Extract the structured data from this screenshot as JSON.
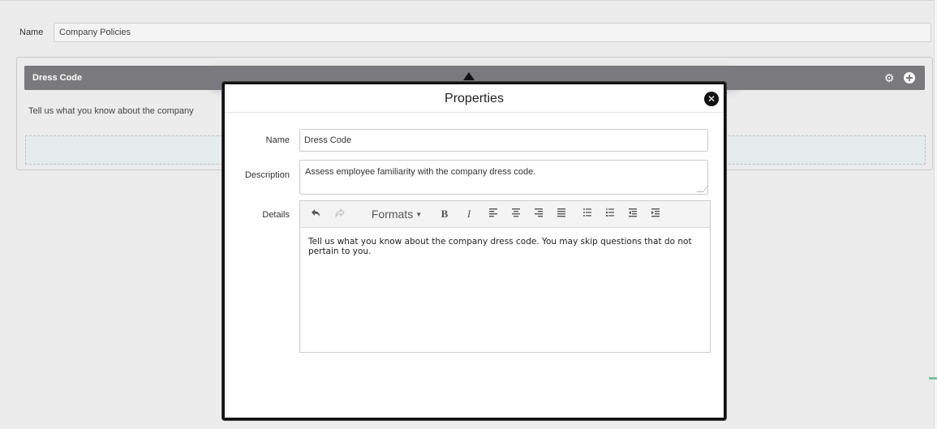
{
  "form": {
    "name_label": "Name",
    "name_value": "Company Policies"
  },
  "section": {
    "title": "Dress Code",
    "description": "Tell us what you know about the company",
    "icons": [
      "gear-icon",
      "add-circle-icon"
    ]
  },
  "dialog": {
    "title": "Properties",
    "close_icon": "close-icon",
    "name_label": "Name",
    "name_value": "Dress Code",
    "description_label": "Description",
    "description_value": "Assess employee familiarity with the company dress code.",
    "details_label": "Details",
    "toolbar": {
      "formats_label": "Formats",
      "bold": "B",
      "italic": "I",
      "buttons": [
        "undo-icon",
        "redo-icon",
        "formats-dropdown",
        "bold-icon",
        "italic-icon",
        "align-left-icon",
        "align-center-icon",
        "align-right-icon",
        "align-justify-icon",
        "bullet-list-icon",
        "numbered-list-icon",
        "outdent-icon",
        "indent-icon"
      ]
    },
    "details_value": "Tell us what you know about the company dress code. You may skip questions that do not pertain to you."
  }
}
